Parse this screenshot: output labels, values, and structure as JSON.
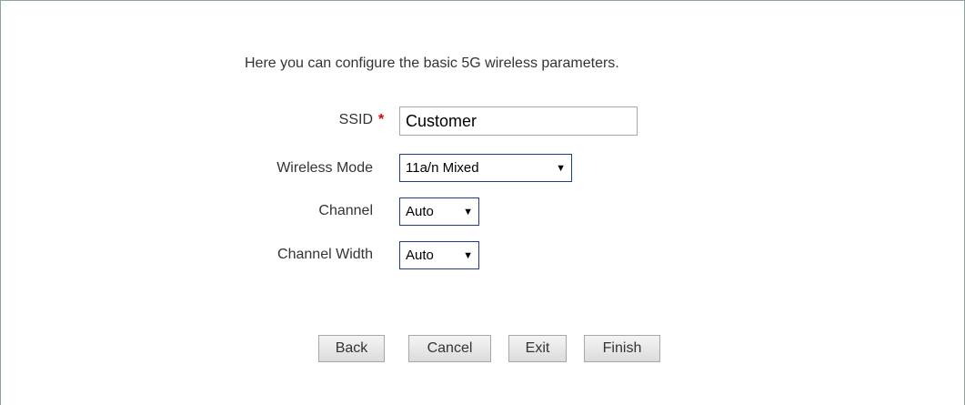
{
  "intro_text": "Here you can configure the basic 5G wireless parameters.",
  "form": {
    "ssid": {
      "label": "SSID",
      "required_marker": "*",
      "value": "Customer"
    },
    "wireless_mode": {
      "label": "Wireless Mode",
      "selected": "11a/n Mixed"
    },
    "channel": {
      "label": "Channel",
      "selected": "Auto"
    },
    "channel_width": {
      "label": "Channel Width",
      "selected": "Auto"
    }
  },
  "buttons": {
    "back": "Back",
    "cancel": "Cancel",
    "exit": "Exit",
    "finish": "Finish"
  },
  "icons": {
    "dropdown": "triangle-down-icon"
  },
  "colors": {
    "required": "#e60000",
    "select_border": "#1c3d8a",
    "frame_border": "#8fa3a0"
  }
}
